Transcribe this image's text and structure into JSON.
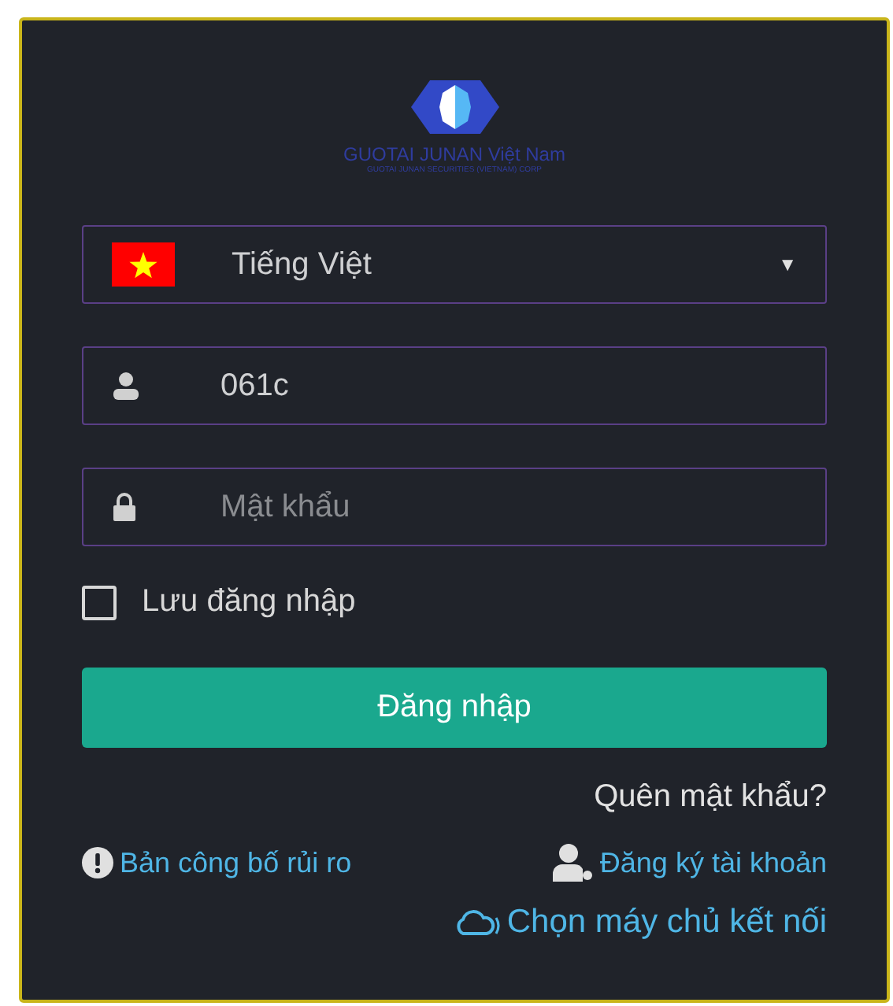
{
  "logo": {
    "name": "GUOTAI JUNAN Việt Nam",
    "subtitle": "GUOTAI JUNAN SECURITIES (VIETNAM) CORP"
  },
  "language": {
    "value": "Tiếng Việt",
    "caret": "▼"
  },
  "username": {
    "value": "061c"
  },
  "password": {
    "placeholder": "Mật khẩu"
  },
  "remember": {
    "label": "Lưu đăng nhập",
    "checked": false
  },
  "login_button": "Đăng nhập",
  "forgot_link": "Quên mật khẩu?",
  "risk_link": "Bản công bố rủi ro",
  "register_link": "Đăng ký tài khoản",
  "server_link": "Chọn máy chủ kết nối"
}
